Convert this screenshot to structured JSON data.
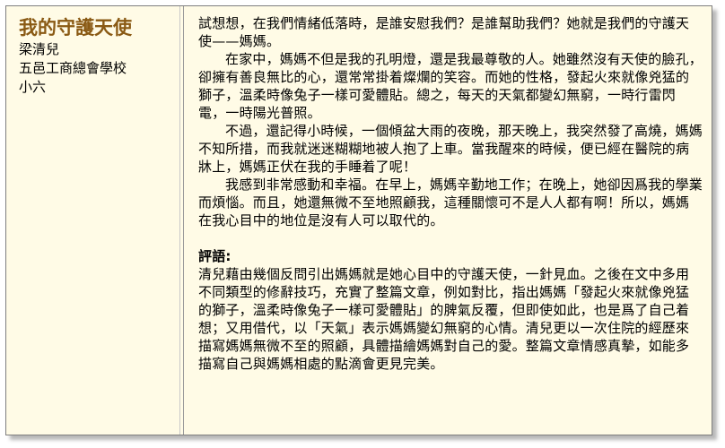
{
  "sidebar": {
    "title": "我的守護天使",
    "author": "梁清兒",
    "school": "五邑工商總會學校",
    "grade": "小六"
  },
  "essay": {
    "paragraphs": [
      "試想想，在我們情緒低落時，是誰安慰我們？是誰幫助我們？她就是我們的守護天使——媽媽。",
      "在家中，媽媽不但是我的孔明燈，還是我最尊敬的人。她雖然沒有天使的臉孔，卻擁有善良無比的心，還常常掛着燦爛的笑容。而她的性格，發起火來就像兇猛的獅子，溫柔時像兔子一樣可愛體貼。總之，每天的天氣都變幻無窮，一時行雷閃電，一時陽光普照。",
      "不過，還記得小時候，一個傾盆大雨的夜晚，那天晚上，我突然發了高燒，媽媽不知所措，而我就迷迷糊糊地被人抱了上車。當我醒來的時候，便已經在醫院的病牀上，媽媽正伏在我的手睡着了呢！",
      "我感到非常感動和幸福。在早上，媽媽辛勤地工作；在晚上，她卻因爲我的學業而煩惱。而且，她還無微不至地照顧我，這種關懷可不是人人都有啊！所以，媽媽在我心目中的地位是沒有人可以取代的。"
    ]
  },
  "comment": {
    "title": "評語:",
    "text": "清兒藉由幾個反問引出媽媽就是她心目中的守護天使，一針見血。之後在文中多用不同類型的修辭技巧，充實了整篇文章，例如對比，指出媽媽「發起火來就像兇猛的獅子，溫柔時像兔子一樣可愛體貼」的脾氣反覆，但即使如此，也是爲了自己着想；又用借代，以「天氣」表示媽媽變幻無窮的心情。清兒更以一次住院的經歷來描寫媽媽無微不至的照顧，具體描繪媽媽對自己的愛。整篇文章情感真摯，如能多描寫自己與媽媽相處的點滴會更見完美。"
  }
}
